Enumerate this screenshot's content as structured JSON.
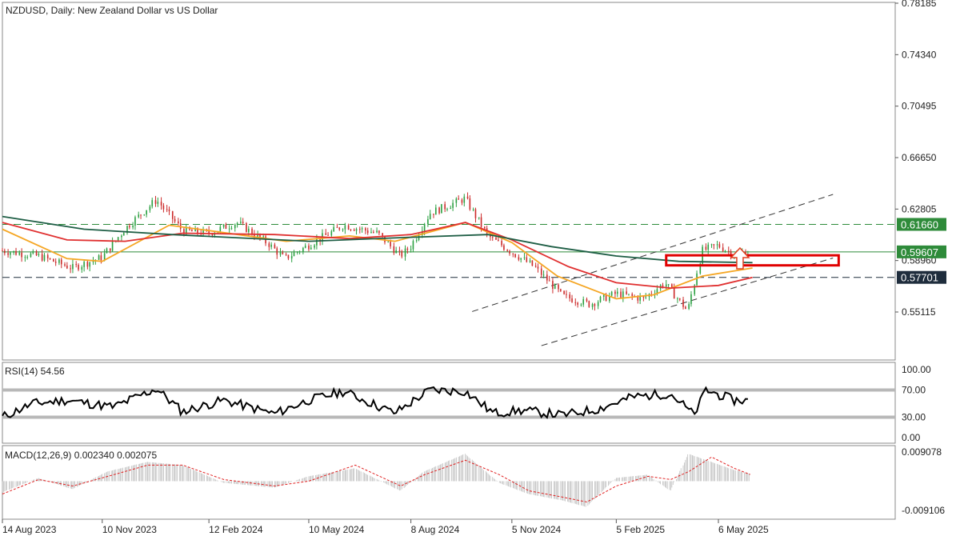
{
  "chart_data": [
    {
      "type": "candlestick",
      "title": "NZDUSD, Daily:  New Zealand Dollar vs US Dollar",
      "ylim": [
        0.51,
        0.7818
      ],
      "y_ticks": [
        "0.78185",
        "0.74340",
        "0.70495",
        "0.66650",
        "0.62805",
        "0.58960",
        "0.55115"
      ],
      "x_ticks": [
        "14 Aug 2023",
        "10 Nov 2023",
        "12 Feb 2024",
        "10 May 2024",
        "8 Aug 2024",
        "5 Nov 2024",
        "5 Feb 2025",
        "6 May 2025"
      ],
      "price_series": [
        {
          "date": "2023-08-14",
          "value": 0.597
        },
        {
          "date": "2023-09-15",
          "value": 0.593
        },
        {
          "date": "2023-10-15",
          "value": 0.584
        },
        {
          "date": "2023-11-10",
          "value": 0.592
        },
        {
          "date": "2023-12-01",
          "value": 0.614
        },
        {
          "date": "2023-12-28",
          "value": 0.635
        },
        {
          "date": "2024-01-20",
          "value": 0.612
        },
        {
          "date": "2024-02-12",
          "value": 0.61
        },
        {
          "date": "2024-03-08",
          "value": 0.618
        },
        {
          "date": "2024-04-05",
          "value": 0.602
        },
        {
          "date": "2024-04-19",
          "value": 0.591
        },
        {
          "date": "2024-05-10",
          "value": 0.601
        },
        {
          "date": "2024-06-10",
          "value": 0.616
        },
        {
          "date": "2024-07-10",
          "value": 0.61
        },
        {
          "date": "2024-07-30",
          "value": 0.593
        },
        {
          "date": "2024-08-08",
          "value": 0.6
        },
        {
          "date": "2024-08-25",
          "value": 0.625
        },
        {
          "date": "2024-09-25",
          "value": 0.636
        },
        {
          "date": "2024-10-15",
          "value": 0.608
        },
        {
          "date": "2024-11-05",
          "value": 0.596
        },
        {
          "date": "2024-11-25",
          "value": 0.585
        },
        {
          "date": "2024-12-20",
          "value": 0.563
        },
        {
          "date": "2025-01-13",
          "value": 0.557
        },
        {
          "date": "2025-02-05",
          "value": 0.565
        },
        {
          "date": "2025-03-01",
          "value": 0.561
        },
        {
          "date": "2025-03-20",
          "value": 0.573
        },
        {
          "date": "2025-04-09",
          "value": 0.552
        },
        {
          "date": "2025-04-22",
          "value": 0.597
        },
        {
          "date": "2025-05-06",
          "value": 0.601
        },
        {
          "date": "2025-05-20",
          "value": 0.594
        },
        {
          "date": "2025-06-03",
          "value": 0.596
        }
      ],
      "moving_averages": [
        {
          "color": "#f5a623",
          "points": [
            {
              "date": "2023-08-14",
              "value": 0.613
            },
            {
              "date": "2023-10-10",
              "value": 0.591
            },
            {
              "date": "2023-11-10",
              "value": 0.589
            },
            {
              "date": "2024-01-08",
              "value": 0.616
            },
            {
              "date": "2024-02-12",
              "value": 0.612
            },
            {
              "date": "2024-04-20",
              "value": 0.604
            },
            {
              "date": "2024-06-15",
              "value": 0.608
            },
            {
              "date": "2024-07-25",
              "value": 0.604
            },
            {
              "date": "2024-09-25",
              "value": 0.618
            },
            {
              "date": "2024-11-05",
              "value": 0.603
            },
            {
              "date": "2024-12-15",
              "value": 0.578
            },
            {
              "date": "2025-02-05",
              "value": 0.561
            },
            {
              "date": "2025-03-10",
              "value": 0.564
            },
            {
              "date": "2025-04-22",
              "value": 0.578
            },
            {
              "date": "2025-06-05",
              "value": 0.584
            }
          ]
        },
        {
          "color": "#e03030",
          "points": [
            {
              "date": "2023-08-14",
              "value": 0.618
            },
            {
              "date": "2023-10-10",
              "value": 0.605
            },
            {
              "date": "2023-11-30",
              "value": 0.604
            },
            {
              "date": "2024-01-20",
              "value": 0.61
            },
            {
              "date": "2024-04-10",
              "value": 0.609
            },
            {
              "date": "2024-06-15",
              "value": 0.606
            },
            {
              "date": "2024-08-08",
              "value": 0.609
            },
            {
              "date": "2024-09-25",
              "value": 0.618
            },
            {
              "date": "2024-11-05",
              "value": 0.605
            },
            {
              "date": "2024-12-25",
              "value": 0.585
            },
            {
              "date": "2025-02-05",
              "value": 0.573
            },
            {
              "date": "2025-03-25",
              "value": 0.569
            },
            {
              "date": "2025-05-06",
              "value": 0.571
            },
            {
              "date": "2025-06-05",
              "value": 0.577
            }
          ]
        },
        {
          "color": "#1e5e45",
          "points": [
            {
              "date": "2023-08-14",
              "value": 0.6225
            },
            {
              "date": "2023-10-25",
              "value": 0.613
            },
            {
              "date": "2024-01-10",
              "value": 0.609
            },
            {
              "date": "2024-05-10",
              "value": 0.604
            },
            {
              "date": "2024-08-08",
              "value": 0.607
            },
            {
              "date": "2024-10-15",
              "value": 0.609
            },
            {
              "date": "2024-12-10",
              "value": 0.6
            },
            {
              "date": "2025-02-05",
              "value": 0.593
            },
            {
              "date": "2025-04-01",
              "value": 0.589
            },
            {
              "date": "2025-06-05",
              "value": 0.588
            }
          ]
        }
      ],
      "horizontal_levels": [
        {
          "value": 0.6166,
          "label": "0.61660",
          "color": "#2e8b3a",
          "style": "dashed"
        },
        {
          "value": 0.59607,
          "label": "0.59607",
          "color": "#2e8b3a",
          "style": "solid"
        },
        {
          "value": 0.57701,
          "label": "0.57701",
          "color": "#1f2d3d",
          "style": "dashed"
        }
      ],
      "channel": {
        "upper": [
          {
            "date": "2024-10-01",
            "value": 0.5515
          },
          {
            "date": "2025-08-15",
            "value": 0.639
          }
        ],
        "lower": [
          {
            "date": "2024-12-01",
            "value": 0.526
          },
          {
            "date": "2025-08-15",
            "value": 0.5915
          }
        ]
      },
      "support_zone": {
        "start": "2025-03-21",
        "end": "2025-08-20",
        "low": 0.586,
        "high": 0.5935,
        "color": "#e00000"
      },
      "arrow": {
        "date": "2025-05-25",
        "value": 0.599,
        "direction": "up",
        "color": "#e04020"
      }
    },
    {
      "type": "line",
      "title": "RSI(14) 54.56",
      "ylim": [
        0,
        100
      ],
      "y_ticks": [
        "100.00",
        "70.00",
        "30.00",
        "0.00"
      ],
      "levels": [
        70,
        30
      ],
      "x": [
        "2023-08-14",
        "2023-09-10",
        "2023-10-10",
        "2023-11-20",
        "2023-12-28",
        "2024-01-20",
        "2024-02-25",
        "2024-04-10",
        "2024-05-10",
        "2024-06-10",
        "2024-07-25",
        "2024-08-25",
        "2024-09-25",
        "2024-10-20",
        "2024-11-15",
        "2024-12-20",
        "2025-01-20",
        "2025-02-20",
        "2025-03-25",
        "2025-04-15",
        "2025-04-25",
        "2025-05-20",
        "2025-06-03"
      ],
      "values": [
        30,
        50,
        55,
        45,
        72,
        38,
        55,
        35,
        55,
        68,
        36,
        70,
        68,
        36,
        40,
        33,
        42,
        60,
        65,
        33,
        70,
        55,
        54.56
      ]
    },
    {
      "type": "bar",
      "title": "MACD(12,26,9) 0.002340 0.002075",
      "ylim": [
        -0.009106,
        0.009078
      ],
      "y_ticks": [
        "0.009078",
        "-0.009106"
      ],
      "x": [
        "2023-08-14",
        "2023-09-15",
        "2023-10-15",
        "2023-11-15",
        "2023-12-20",
        "2024-01-20",
        "2024-02-25",
        "2024-04-10",
        "2024-05-10",
        "2024-06-20",
        "2024-07-30",
        "2024-08-20",
        "2024-09-25",
        "2024-10-25",
        "2024-11-20",
        "2024-12-20",
        "2025-01-10",
        "2025-02-05",
        "2025-03-05",
        "2025-03-25",
        "2025-04-10",
        "2025-04-30",
        "2025-05-20",
        "2025-06-03"
      ],
      "histogram": [
        -0.0035,
        0.001,
        -0.0025,
        0.003,
        0.006,
        0.005,
        -0.0005,
        -0.002,
        0.0015,
        0.004,
        -0.003,
        0.003,
        0.0085,
        -0.0005,
        -0.004,
        -0.006,
        -0.008,
        0.001,
        0.002,
        -0.003,
        0.0085,
        0.006,
        0.0035,
        0.00234
      ],
      "signal": [
        -0.004,
        0.0005,
        -0.0015,
        0.0015,
        0.005,
        0.005,
        0.0005,
        -0.0015,
        0.0,
        0.005,
        -0.0015,
        0.002,
        0.0065,
        0.002,
        -0.003,
        -0.005,
        -0.0065,
        -0.0015,
        0.0015,
        0.0005,
        0.003,
        0.0075,
        0.004,
        0.002075
      ]
    }
  ]
}
